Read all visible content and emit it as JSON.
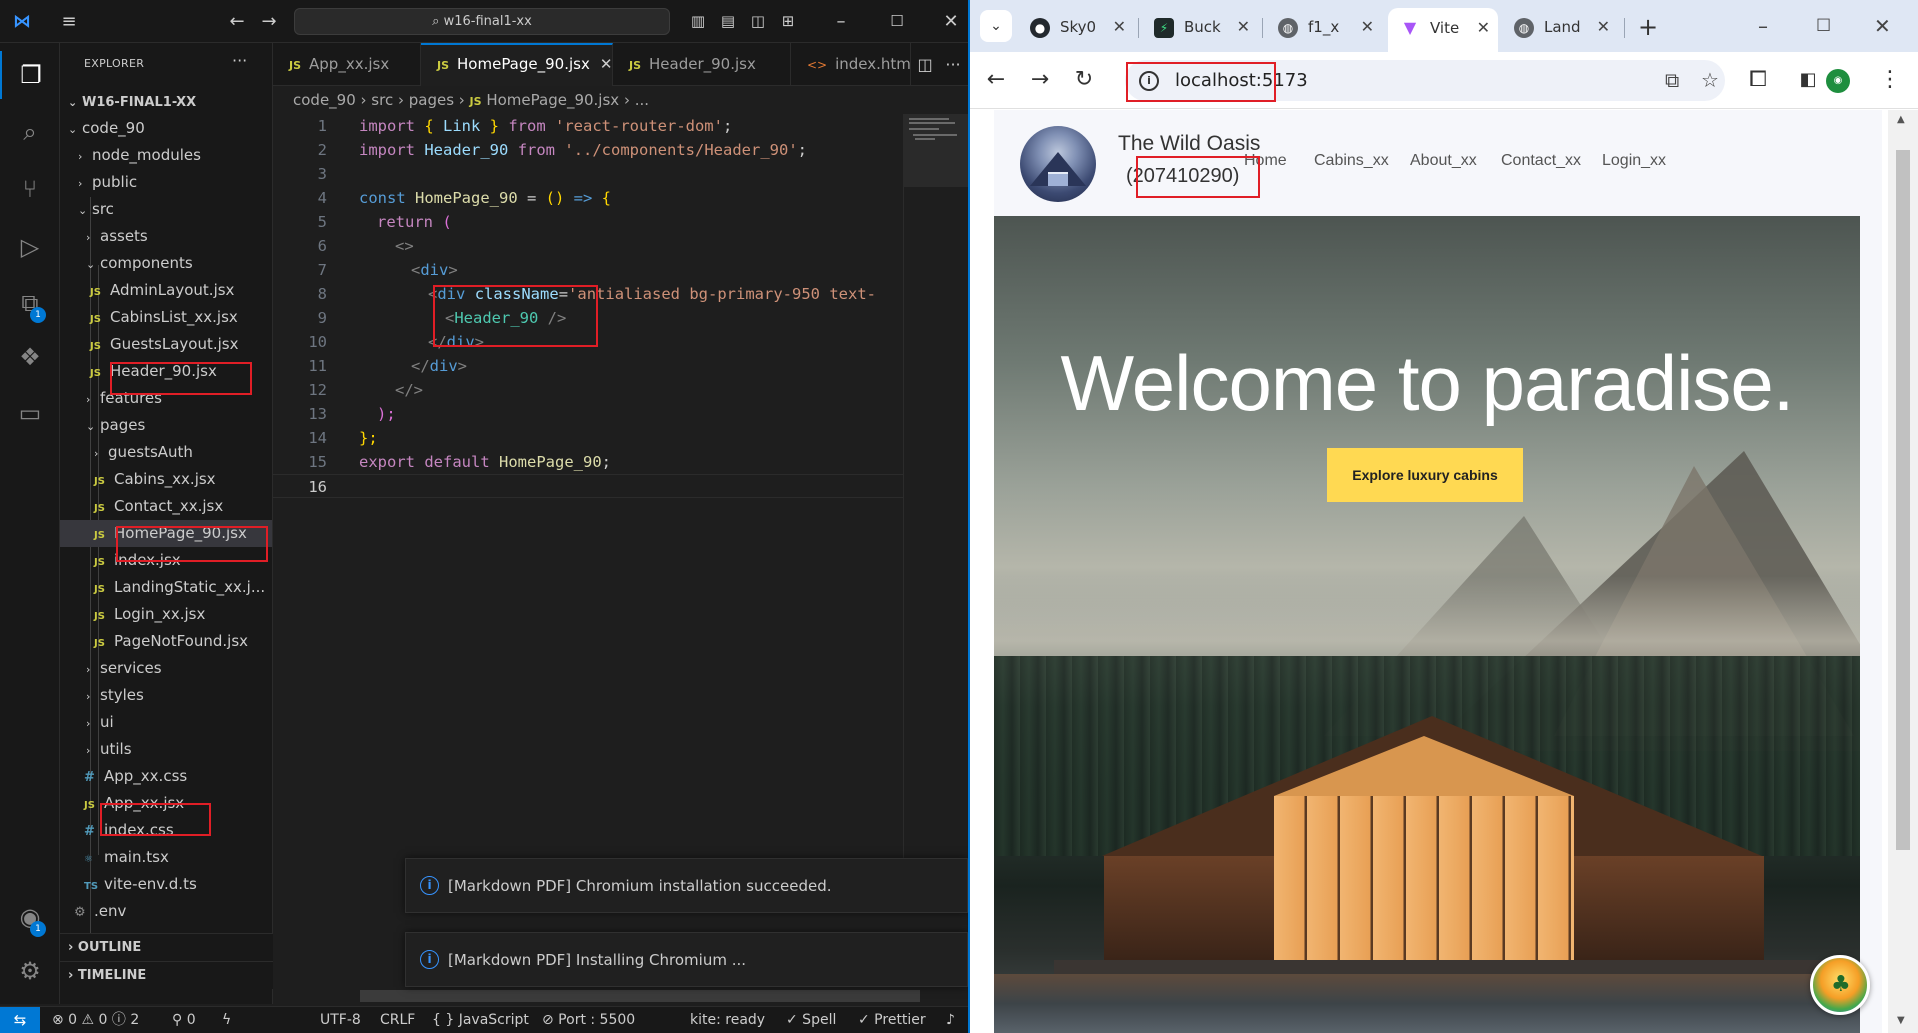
{
  "vscode": {
    "window_title": "w16-final1-xx",
    "activity": [
      "explorer-icon",
      "search-icon",
      "source-control-icon",
      "run-debug-icon",
      "extensions-icon",
      "python-icon",
      "remote-explorer-icon"
    ],
    "extensions_badge": "1",
    "accounts_badge": "1",
    "explorer": {
      "title": "EXPLORER",
      "more": "···",
      "root": "W16-FINAL1-XX",
      "items": [
        {
          "label": "code_90",
          "chev": "⌄"
        },
        {
          "label": "node_modules",
          "chev": "›"
        },
        {
          "label": "public",
          "chev": "›"
        },
        {
          "label": "src",
          "chev": "⌄"
        },
        {
          "label": "assets",
          "chev": "›"
        },
        {
          "label": "components",
          "chev": "⌄"
        },
        {
          "label": "AdminLayout.jsx",
          "icon": "JS"
        },
        {
          "label": "CabinsList_xx.jsx",
          "icon": "JS"
        },
        {
          "label": "GuestsLayout.jsx",
          "icon": "JS"
        },
        {
          "label": "Header_90.jsx",
          "icon": "JS"
        },
        {
          "label": "features",
          "chev": "›"
        },
        {
          "label": "pages",
          "chev": "⌄"
        },
        {
          "label": "guestsAuth",
          "chev": "›"
        },
        {
          "label": "Cabins_xx.jsx",
          "icon": "JS"
        },
        {
          "label": "Contact_xx.jsx",
          "icon": "JS"
        },
        {
          "label": "HomePage_90.jsx",
          "icon": "JS"
        },
        {
          "label": "index.jsx",
          "icon": "JS"
        },
        {
          "label": "LandingStatic_xx.j...",
          "icon": "JS"
        },
        {
          "label": "Login_xx.jsx",
          "icon": "JS"
        },
        {
          "label": "PageNotFound.jsx",
          "icon": "JS"
        },
        {
          "label": "services",
          "chev": "›"
        },
        {
          "label": "styles",
          "chev": "›"
        },
        {
          "label": "ui",
          "chev": "›"
        },
        {
          "label": "utils",
          "chev": "›"
        },
        {
          "label": "App_xx.css",
          "icon": "#"
        },
        {
          "label": "App_xx.jsx",
          "icon": "JS"
        },
        {
          "label": "index.css",
          "icon": "#"
        },
        {
          "label": "main.tsx",
          "icon": "⚛"
        },
        {
          "label": "vite-env.d.ts",
          "icon": "TS"
        },
        {
          "label": ".env",
          "icon": "⚙"
        }
      ],
      "outline": "OUTLINE",
      "timeline": "TIMELINE"
    },
    "tabs": [
      {
        "label": "App_xx.jsx",
        "icon": "JS"
      },
      {
        "label": "HomePage_90.jsx",
        "icon": "JS",
        "close": "✕"
      },
      {
        "label": "Header_90.jsx",
        "icon": "JS"
      },
      {
        "label": "index.htm",
        "icon": "<>"
      }
    ],
    "breadcrumb": {
      "parts": "code_90 › src › pages › ",
      "icon": "JS",
      "file": "HomePage_90.jsx",
      "tail": " › ..."
    },
    "code": {
      "l1": {
        "a": "import",
        "b": " { ",
        "c": "Link",
        "d": " } ",
        "e": "from",
        "f": " ",
        "g": "'react-router-dom'",
        "h": ";"
      },
      "l2": {
        "a": "import",
        "b": " ",
        "c": "Header_90",
        "d": " ",
        "e": "from",
        "f": " ",
        "g": "'../components/Header_90'",
        "h": ";"
      },
      "l4": {
        "a": "const",
        "b": " ",
        "c": "HomePage_90",
        "d": " = ",
        "e": "()",
        "f": " => ",
        "g": "{"
      },
      "l5": {
        "a": "return",
        "b": " ("
      },
      "l6": {
        "a": "<>"
      },
      "l7": {
        "a": "<",
        "b": "div",
        "c": ">"
      },
      "l8": {
        "a": "<",
        "b": "div",
        "c": " ",
        "d": "className",
        "e": "=",
        "f": "'antialiased bg-primary-950 text-"
      },
      "l9": {
        "a": "<",
        "b": "Header_90",
        "c": " />"
      },
      "l10": {
        "a": "</",
        "b": "div",
        "c": ">"
      },
      "l11": {
        "a": "</",
        "b": "div",
        "c": ">"
      },
      "l12": {
        "a": "</>"
      },
      "l13": {
        "a": ");"
      },
      "l14": {
        "a": "};"
      },
      "l15": {
        "a": "export",
        "b": " ",
        "c": "default",
        "d": " ",
        "e": "HomePage_90",
        "f": ";"
      }
    },
    "line_numbers": [
      "1",
      "2",
      "3",
      "4",
      "5",
      "6",
      "7",
      "8",
      "9",
      "10",
      "11",
      "12",
      "13",
      "14",
      "15",
      "16"
    ],
    "notifications": [
      "[Markdown PDF] Chromium installation succeeded.",
      "[Markdown PDF] Installing Chromium ..."
    ],
    "status": {
      "errors": "⊗ 0 ⚠ 0 ⓘ 2",
      "ports": "⚲ 0",
      "encoding": "UTF-8",
      "eol": "CRLF",
      "language": "{ } JavaScript",
      "port": "⊘ Port : 5500",
      "kite": "kite: ready",
      "spell": "✓ Spell",
      "prettier": "✓ Prettier"
    }
  },
  "browser": {
    "tabs": [
      {
        "label": "Sky0",
        "icon": "github-icon"
      },
      {
        "label": "Buck",
        "icon": "bucket-icon"
      },
      {
        "label": "f1_x",
        "icon": "globe-icon"
      },
      {
        "label": "Vite",
        "icon": "vite-icon"
      },
      {
        "label": "Land",
        "icon": "globe-icon"
      }
    ],
    "url": "localhost:5173",
    "site": {
      "brand_name": "The Wild Oasis",
      "brand_id": "(207410290)",
      "nav": [
        "Home",
        "Cabins_xx",
        "About_xx",
        "Contact_xx",
        "Login_xx"
      ],
      "hero_title": "Welcome to paradise.",
      "hero_button": "Explore luxury cabins"
    }
  }
}
